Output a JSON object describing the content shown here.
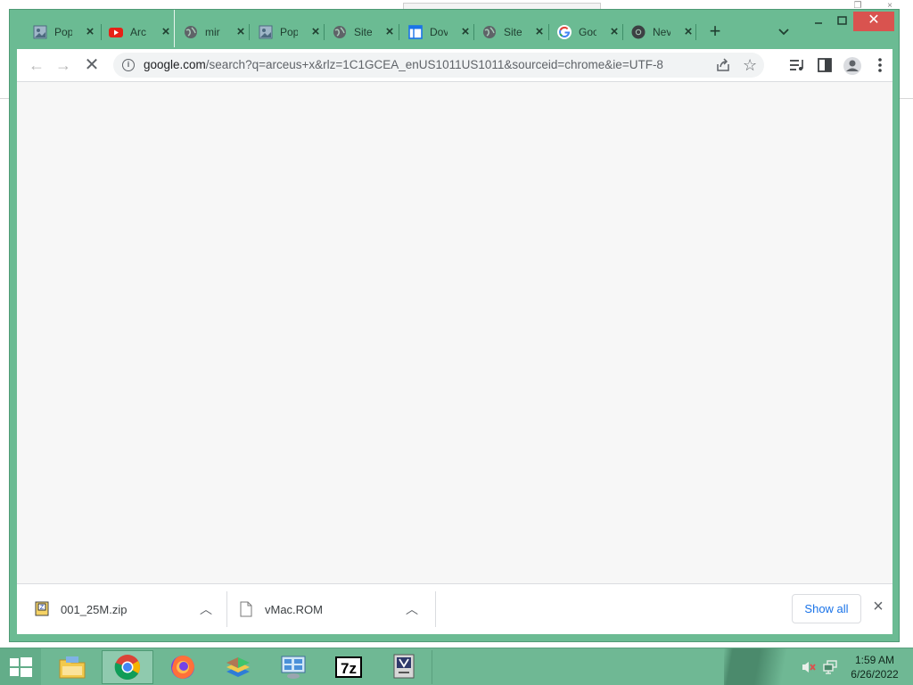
{
  "browser": {
    "tabs": [
      {
        "title": "Pop",
        "favicon": "image-icon"
      },
      {
        "title": "Arc",
        "favicon": "youtube-icon"
      },
      {
        "title": "mir",
        "favicon": "globe-icon"
      },
      {
        "title": "Pop",
        "favicon": "image-icon"
      },
      {
        "title": "Site",
        "favicon": "globe-icon"
      },
      {
        "title": "Dov",
        "favicon": "window-icon"
      },
      {
        "title": "Site",
        "favicon": "globe-icon"
      },
      {
        "title": "Goo",
        "favicon": "google-icon"
      },
      {
        "title": "Nev",
        "favicon": "chrome-icon"
      }
    ],
    "url_host": "google.com",
    "url_path": "/search?q=arceus+x&rlz=1C1GCEA_enUS1011US1011&sourceid=chrome&ie=UTF-8",
    "colors": {
      "frame": "#6bbb93",
      "close": "#d9534f",
      "link": "#1a73e8"
    }
  },
  "downloads": {
    "items": [
      {
        "name": "001_25M.zip",
        "icon": "zip-file-icon"
      },
      {
        "name": "vMac.ROM",
        "icon": "file-icon"
      }
    ],
    "show_all": "Show all"
  },
  "taskbar": {
    "apps": [
      "file-explorer-icon",
      "chrome-icon",
      "firefox-icon",
      "bluestacks-icon",
      "control-panel-icon",
      "7zip-icon",
      "vmac-icon"
    ],
    "active_app": "chrome-icon",
    "clock_time": "1:59 AM",
    "clock_date": "6/26/2022"
  }
}
